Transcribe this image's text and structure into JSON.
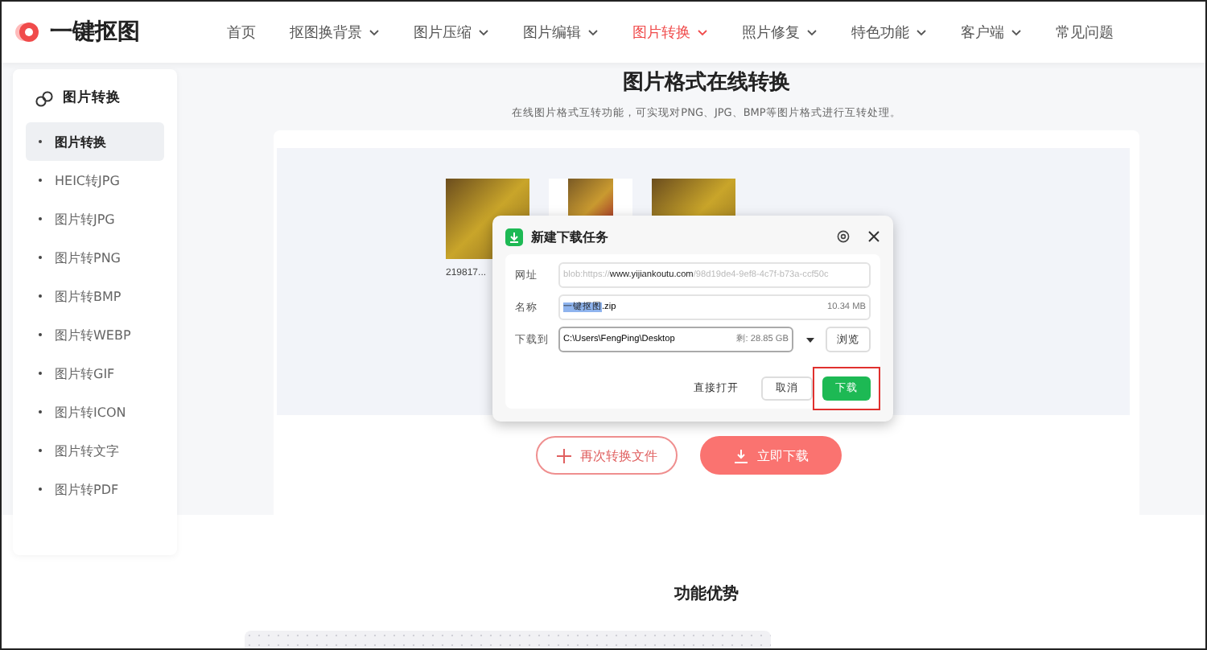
{
  "logo": {
    "text": "一键抠图"
  },
  "nav": [
    {
      "label": "首页",
      "dropdown": false,
      "selected": false
    },
    {
      "label": "抠图换背景",
      "dropdown": true,
      "selected": false
    },
    {
      "label": "图片压缩",
      "dropdown": true,
      "selected": false
    },
    {
      "label": "图片编辑",
      "dropdown": true,
      "selected": false
    },
    {
      "label": "图片转换",
      "dropdown": true,
      "selected": true
    },
    {
      "label": "照片修复",
      "dropdown": true,
      "selected": false
    },
    {
      "label": "特色功能",
      "dropdown": true,
      "selected": false
    },
    {
      "label": "客户端",
      "dropdown": true,
      "selected": false
    },
    {
      "label": "常见问题",
      "dropdown": false,
      "selected": false
    }
  ],
  "sidebar": {
    "title": "图片转换",
    "items": [
      {
        "label": "图片转换",
        "selected": true
      },
      {
        "label": "HEIC转JPG",
        "selected": false
      },
      {
        "label": "图片转JPG",
        "selected": false
      },
      {
        "label": "图片转PNG",
        "selected": false
      },
      {
        "label": "图片转BMP",
        "selected": false
      },
      {
        "label": "图片转WEBP",
        "selected": false
      },
      {
        "label": "图片转GIF",
        "selected": false
      },
      {
        "label": "图片转ICON",
        "selected": false
      },
      {
        "label": "图片转文字",
        "selected": false
      },
      {
        "label": "图片转PDF",
        "selected": false
      }
    ]
  },
  "page": {
    "title": "图片格式在线转换",
    "subtitle": "在线图片格式互转功能，可实现对PNG、JPG、BMP等图片格式进行互转处理。"
  },
  "thumbnails": [
    {
      "kind": "full",
      "caption": "219817..."
    },
    {
      "kind": "framed"
    },
    {
      "kind": "full"
    }
  ],
  "dialog": {
    "title": "新建下载任务",
    "url_label": "网址",
    "url": [
      {
        "text": "blob:https://",
        "emphasis": false
      },
      {
        "text": "www.yijiankoutu.com",
        "emphasis": true
      },
      {
        "text": "/98d19de4-9ef8-4c7f-b73a-ccf50c",
        "emphasis": false
      }
    ],
    "name_label": "名称",
    "name_selected": "一键抠图",
    "name_rest": ".zip",
    "size": "10.34 MB",
    "path_label": "下载到",
    "path": "C:\\Users\\FengPing\\Desktop",
    "free": "剩: 28.85 GB",
    "browse": "浏览",
    "buttons": [
      {
        "label": "直接打开",
        "kind": "text"
      },
      {
        "label": "取消",
        "kind": "plain"
      },
      {
        "label": "下载",
        "kind": "primary",
        "highlighted": true
      }
    ]
  },
  "actions": [
    {
      "label": "再次转换文件",
      "kind": "outline"
    },
    {
      "label": "立即下载",
      "kind": "filled"
    }
  ],
  "features": {
    "title": "功能优势"
  }
}
